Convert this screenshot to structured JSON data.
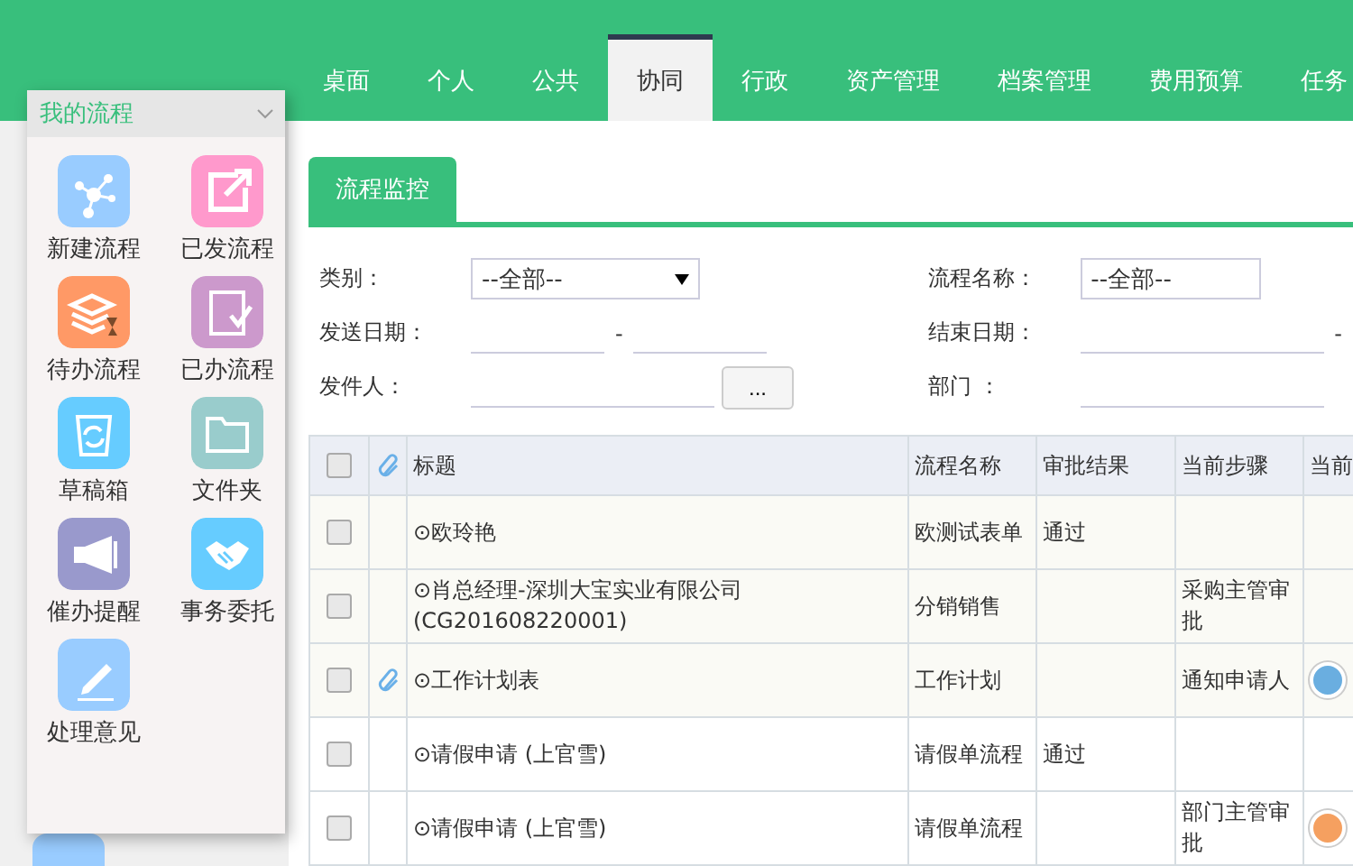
{
  "nav": {
    "tabs": [
      {
        "label": "桌面",
        "selected": false
      },
      {
        "label": "个人",
        "selected": false
      },
      {
        "label": "公共",
        "selected": false
      },
      {
        "label": "协同",
        "selected": true
      },
      {
        "label": "行政",
        "selected": false
      },
      {
        "label": "资产管理",
        "selected": false
      },
      {
        "label": "档案管理",
        "selected": false
      },
      {
        "label": "费用预算",
        "selected": false
      },
      {
        "label": "任务",
        "selected": false
      }
    ]
  },
  "popup": {
    "title": "我的流程",
    "items": [
      {
        "label": "新建流程",
        "kind": "network",
        "color": "#99ccff"
      },
      {
        "label": "已发流程",
        "kind": "share",
        "color": "#ff99cc"
      },
      {
        "label": "待办流程",
        "kind": "stack",
        "color": "#ff9966"
      },
      {
        "label": "已办流程",
        "kind": "book",
        "color": "#cc99cc"
      },
      {
        "label": "草稿箱",
        "kind": "recycle",
        "color": "#66ccff"
      },
      {
        "label": "文件夹",
        "kind": "folder",
        "color": "#99cccc"
      },
      {
        "label": "催办提醒",
        "kind": "megaphone",
        "color": "#9999cc"
      },
      {
        "label": "事务委托",
        "kind": "handshake",
        "color": "#66ccff"
      },
      {
        "label": "处理意见",
        "kind": "pen",
        "color": "#99ccff"
      }
    ]
  },
  "section_tab": "流程监控",
  "filters": {
    "left": [
      {
        "label": "类别：",
        "kind": "select",
        "value": "--全部--"
      },
      {
        "label": "发送日期：",
        "kind": "daterange",
        "separator": "-"
      },
      {
        "label": "发件人：",
        "kind": "picker",
        "button": "..."
      }
    ],
    "right": [
      {
        "label": "流程名称：",
        "kind": "select",
        "value": "--全部--"
      },
      {
        "label": "结束日期：",
        "kind": "daterange",
        "separator": "-"
      },
      {
        "label": "部门 ：",
        "kind": "text"
      }
    ]
  },
  "table": {
    "all_checked": false,
    "columns": [
      "标题",
      "流程名称",
      "审批结果",
      "当前步骤",
      "当前"
    ],
    "rows": [
      {
        "checked": false,
        "attachment": false,
        "title": "⊙欧玲艳",
        "flow": "欧测试表单",
        "result": "通过",
        "step": ""
      },
      {
        "checked": false,
        "attachment": false,
        "title": "⊙肖总经理-深圳大宝实业有限公司(CG201608220001)",
        "flow": "分销销售",
        "result": "",
        "step": "采购主管审批"
      },
      {
        "checked": false,
        "attachment": true,
        "title": "⊙工作计划表",
        "flow": "工作计划",
        "result": "",
        "step": "通知申请人",
        "color": "#6aaee0"
      },
      {
        "checked": false,
        "attachment": false,
        "title": "⊙请假申请 (上官雪)",
        "flow": "请假单流程",
        "result": "通过",
        "step": ""
      },
      {
        "checked": false,
        "attachment": false,
        "title": "⊙请假申请 (上官雪)",
        "flow": "请假单流程",
        "result": "",
        "step": "部门主管审批",
        "color": "#f5a060"
      }
    ]
  }
}
